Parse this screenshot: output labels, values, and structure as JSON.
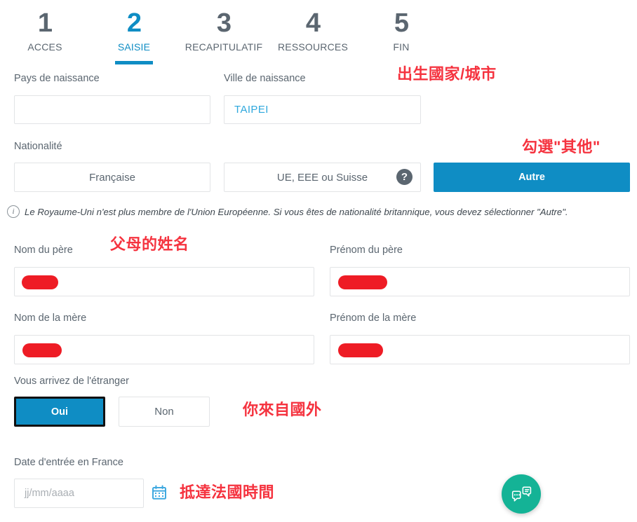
{
  "stepper": {
    "steps": [
      {
        "num": "1",
        "label": "ACCES",
        "active": false
      },
      {
        "num": "2",
        "label": "SAISIE",
        "active": true
      },
      {
        "num": "3",
        "label": "RECAPITULATIF",
        "active": false
      },
      {
        "num": "4",
        "label": "RESSOURCES",
        "active": false
      },
      {
        "num": "5",
        "label": "FIN",
        "active": false
      }
    ],
    "active_color": "#0f8dc4",
    "inactive_color": "#5b6670"
  },
  "form": {
    "birth_country": {
      "label": "Pays de naissance",
      "value": "",
      "placeholder": ""
    },
    "birth_city": {
      "label": "Ville de naissance",
      "value": "TAIPEI",
      "placeholder": ""
    },
    "nationality": {
      "label": "Nationalité",
      "options": [
        "Française",
        "UE, EEE ou Suisse",
        "Autre"
      ],
      "selected": "Autre",
      "help_icon": "question-mark-icon",
      "help_glyph": "?"
    },
    "notice": {
      "icon": "info-icon",
      "icon_glyph": "i",
      "text": "Le Royaume-Uni n'est plus membre de l'Union Européenne. Si vous êtes de nationalité britannique, vous devez sélectionner \"Autre\"."
    },
    "father_lastname": {
      "label": "Nom du père",
      "value": "",
      "redacted": true
    },
    "father_firstname": {
      "label": "Prénom du père",
      "value": "",
      "redacted": true
    },
    "mother_lastname": {
      "label": "Nom de la mère",
      "value": "",
      "redacted": true
    },
    "mother_firstname": {
      "label": "Prénom de la mère",
      "value": "",
      "redacted": true
    },
    "from_abroad": {
      "label": "Vous arrivez de l'étranger",
      "options": [
        "Oui",
        "Non"
      ],
      "selected": "Oui"
    },
    "entry_date": {
      "label": "Date d'entrée en France",
      "value": "",
      "placeholder": "jj/mm/aaaa",
      "calendar_icon": "calendar-icon"
    }
  },
  "annotations": [
    {
      "text": "出生國家/城市",
      "name": "annotation-birth-country-city"
    },
    {
      "text": "勾選\"其他\"",
      "name": "annotation-select-other"
    },
    {
      "text": "父母的姓名",
      "name": "annotation-parents-names"
    },
    {
      "text": "你來自國外",
      "name": "annotation-from-abroad"
    },
    {
      "text": "抵達法國時間",
      "name": "annotation-arrival-date"
    }
  ],
  "chat_widget": {
    "icon": "chat-bubbles-icon",
    "color": "#14b396"
  }
}
